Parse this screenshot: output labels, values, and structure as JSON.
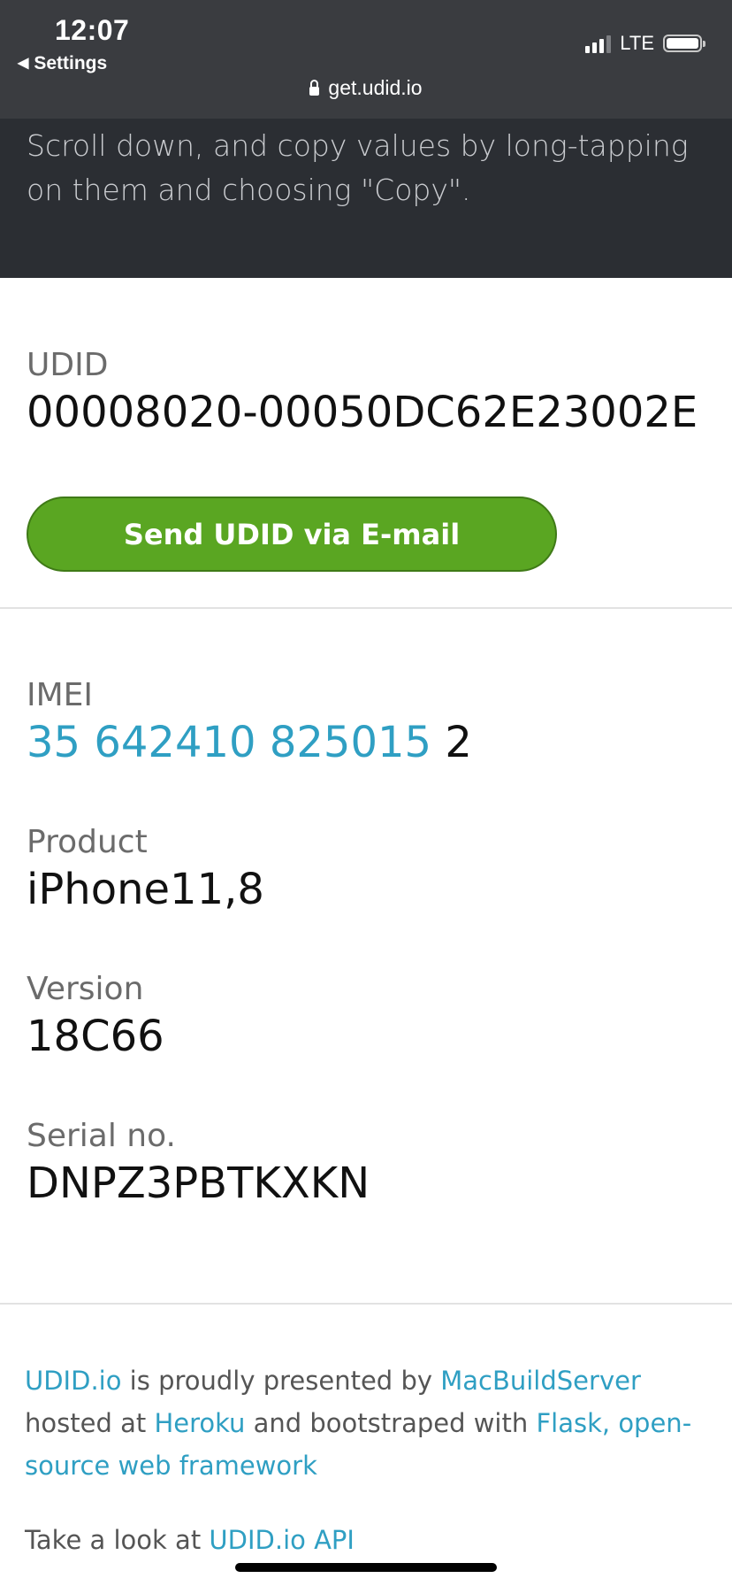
{
  "status_bar": {
    "time": "12:07",
    "back_label": "Settings",
    "carrier": "LTE",
    "url": "get.udid.io"
  },
  "hero": {
    "text": "Scroll down, and copy values by long-tapping on them and choosing \"Copy\"."
  },
  "device": {
    "udid_label": "UDID",
    "udid_value": "00008020-00050DC62E23002E",
    "send_button": "Send UDID via E-mail",
    "imei_label": "IMEI",
    "imei_link_part": "35 642410 825015",
    "imei_tail": " 2",
    "product_label": "Product",
    "product_value": "iPhone11,8",
    "version_label": "Version",
    "version_value": "18C66",
    "serial_label": "Serial no.",
    "serial_value": "DNPZ3PBTKXKN"
  },
  "footer": {
    "udid_link": "UDID.io",
    "text_1": " is proudly presented by ",
    "macbuild_link": "MacBuildServer",
    "text_2": " hosted at ",
    "heroku_link": "Heroku",
    "text_3": " and bootstraped with ",
    "flask_link": "Flask, open-source web framework",
    "api_prefix": "Take a look at ",
    "api_link": "UDID.io API"
  },
  "colors": {
    "chrome": "#3a3c40",
    "hero": "#2b2e33",
    "button": "#5aa622",
    "link": "#2f9fc3"
  }
}
